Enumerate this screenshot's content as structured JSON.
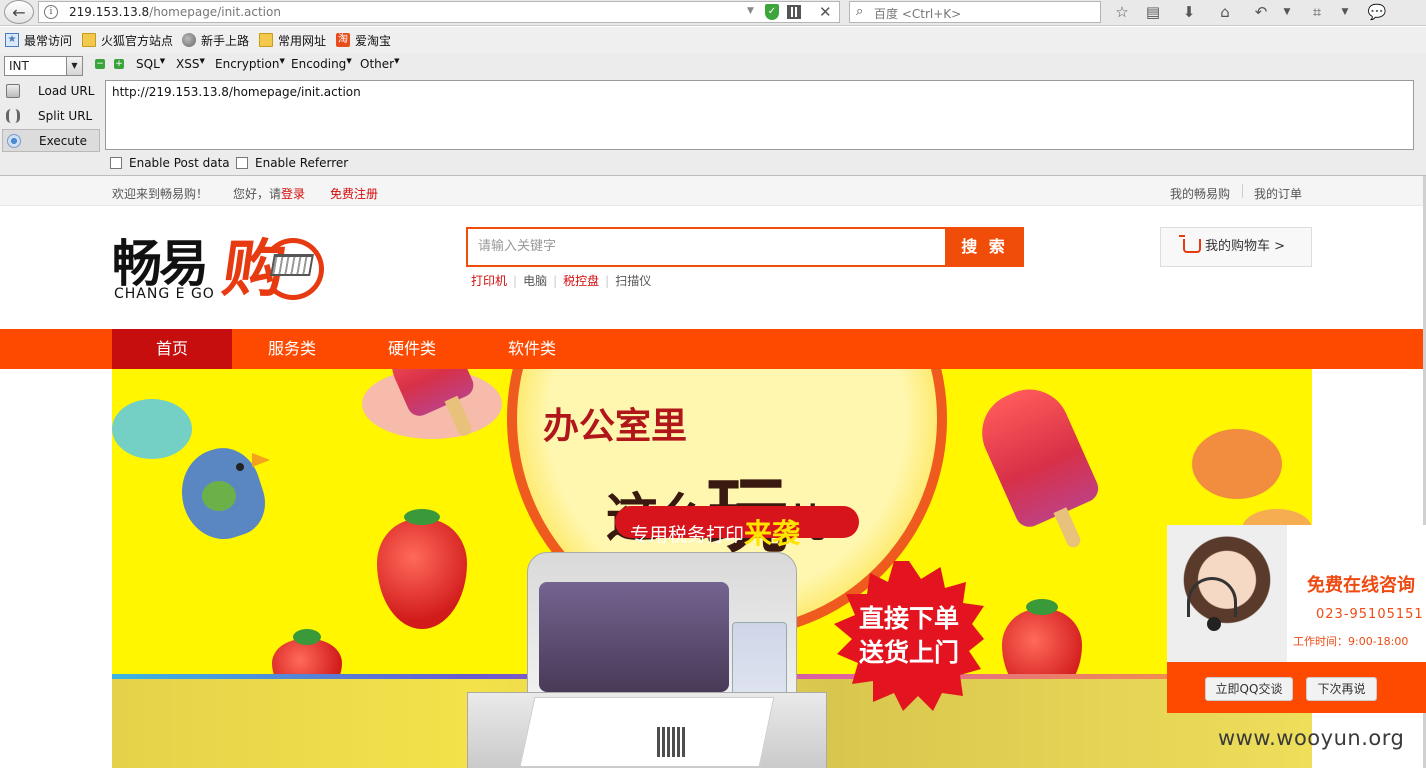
{
  "browser": {
    "url_host": "219.153.13.8",
    "url_path": "/homepage/init.action",
    "search_placeholder": "百度 <Ctrl+K>"
  },
  "bookmarks": [
    "最常访问",
    "火狐官方站点",
    "新手上路",
    "常用网址",
    "爱淘宝"
  ],
  "hackbar": {
    "select_value": "INT",
    "menus": [
      "SQL",
      "XSS",
      "Encryption",
      "Encoding",
      "Other"
    ],
    "actions": [
      "Load URL",
      "Split URL",
      "Execute"
    ],
    "textarea_value": "http://219.153.13.8/homepage/init.action",
    "checkboxes": [
      "Enable Post data",
      "Enable Referrer"
    ]
  },
  "site": {
    "welcome": "欢迎来到畅易购！",
    "greeting": "您好，请",
    "login": "登录",
    "register": "免费注册",
    "my_account": "我的畅易购",
    "my_orders": "我的订单",
    "logo_cn": "畅易",
    "logo_gou": "购",
    "logo_en": "CHANG E GO",
    "search_placeholder": "请输入关键字",
    "search_button": "搜 索",
    "hot_words": [
      "打印机",
      "电脑",
      "税控盘",
      "扫描仪"
    ],
    "cart_label": "我的购物车 >",
    "nav": [
      "首页",
      "服务类",
      "硬件类",
      "软件类"
    ]
  },
  "banner": {
    "line1": "办公室里",
    "line2_a": "这么",
    "line2_b": "玩",
    "line2_c": "儿",
    "pill_a": "专用税务打印",
    "pill_b": "来袭",
    "burst_line1": "直接下单",
    "burst_line2": "送货上门"
  },
  "consult": {
    "title": "免费在线咨询",
    "phone": "023-95105151",
    "hours": "工作时间：9:00-18:00",
    "qq_button": "立即QQ交谈",
    "later_button": "下次再说"
  },
  "watermark": "www.wooyun.org",
  "colors": {
    "brand_orange": "#fe4a01",
    "nav_active": "#c70e0e",
    "link_red": "#d50b0b",
    "banner_yellow": "#fff600"
  }
}
